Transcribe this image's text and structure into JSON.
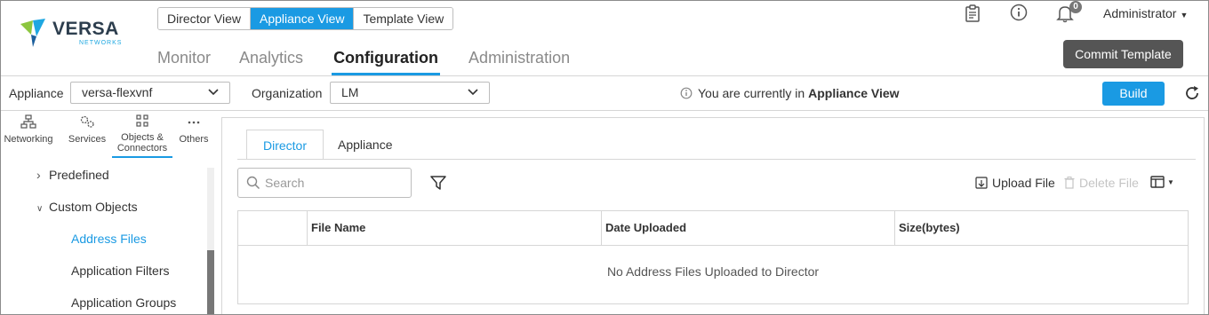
{
  "brand": {
    "name": "VERSA",
    "sub": "NETWORKS"
  },
  "view_switch": [
    "Director View",
    "Appliance View",
    "Template View"
  ],
  "main_nav": [
    "Monitor",
    "Analytics",
    "Configuration",
    "Administration"
  ],
  "header": {
    "notification_count": "0",
    "user": "Administrator",
    "commit_label": "Commit Template"
  },
  "toolbar": {
    "appliance_label": "Appliance",
    "appliance_value": "versa-flexvnf",
    "org_label": "Organization",
    "org_value": "LM",
    "info_prefix": "You are currently in",
    "info_view": "Appliance View",
    "build_label": "Build"
  },
  "sidebar": {
    "tabs": [
      "Networking",
      "Services",
      "Objects &\nConnectors",
      "Others"
    ],
    "tree": [
      "Predefined",
      "Custom Objects",
      "Address Files",
      "Application Filters",
      "Application Groups"
    ]
  },
  "content": {
    "tabs": [
      "Director",
      "Appliance"
    ],
    "search_placeholder": "Search",
    "upload_label": "Upload File",
    "delete_label": "Delete File",
    "columns": [
      "File Name",
      "Date Uploaded",
      "Size(bytes)"
    ],
    "empty_message": "No Address Files Uploaded to Director"
  },
  "colors": {
    "accent": "#1a9ae3",
    "dark_button": "#555555"
  }
}
